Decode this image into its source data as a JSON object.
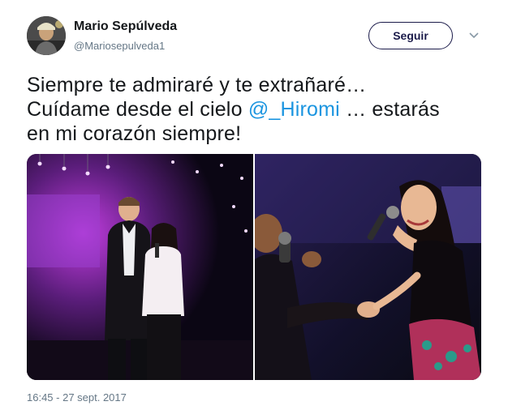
{
  "author": {
    "name": "Mario Sepúlveda",
    "handle": "@Mariosepulveda1"
  },
  "actions": {
    "follow_label": "Seguir"
  },
  "tweet": {
    "line1": "Siempre te admiraré y te extrañaré…",
    "line2_before": "Cuídame desde el cielo ",
    "mention": "@_Hiromi",
    "line2_after": " … estarás",
    "line3": "en mi corazón siempre!"
  },
  "media": {
    "photos": [
      "photo-duet-stage",
      "photo-singer-handshake"
    ]
  },
  "timestamp": "16:45 - 27 sept. 2017",
  "colors": {
    "link": "#1b95e0",
    "button_border": "#1b1b4a",
    "secondary_text": "#657786",
    "stage_purple": "#7a2fb0"
  }
}
